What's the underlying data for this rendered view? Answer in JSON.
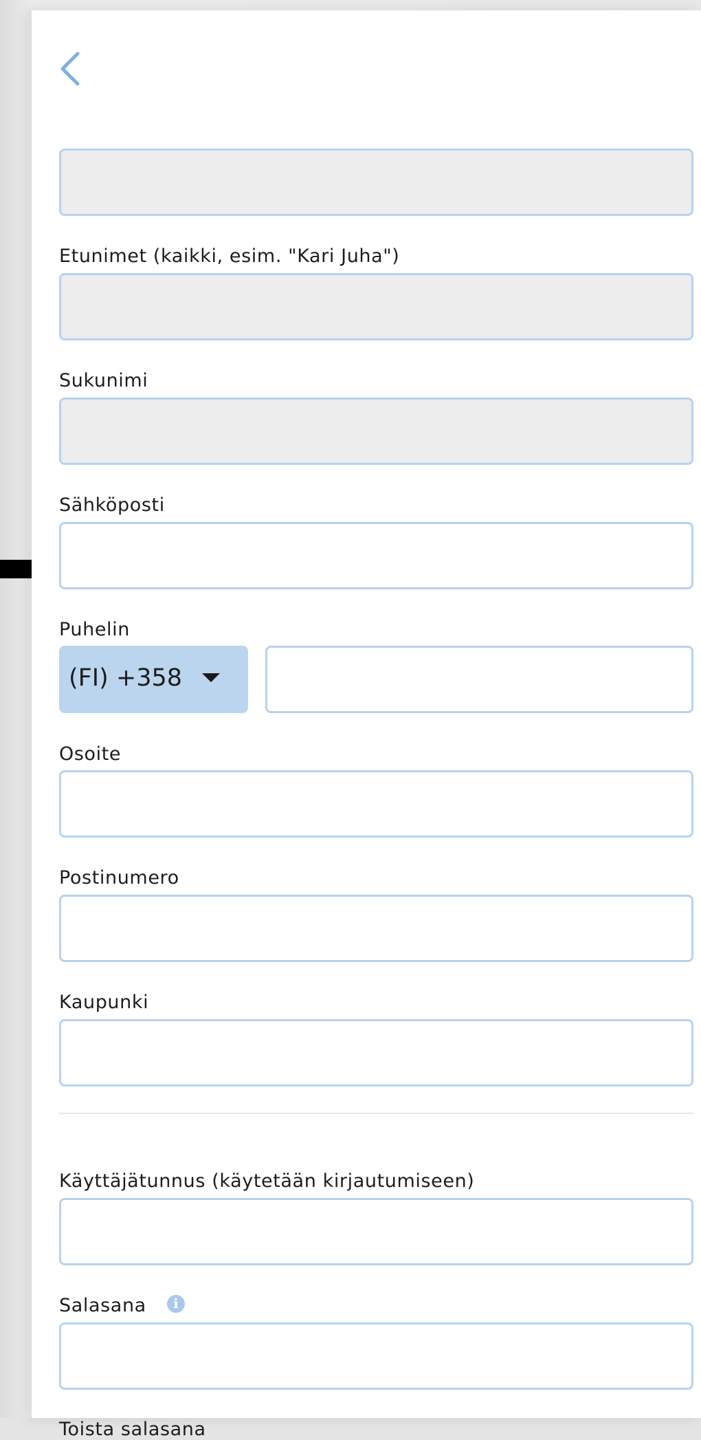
{
  "form": {
    "first_names_label": "Etunimet (kaikki, esim. \"Kari Juha\")",
    "last_name_label": "Sukunimi",
    "email_label": "Sähköposti",
    "phone_label": "Puhelin",
    "phone_country_code": "(FI) +358",
    "address_label": "Osoite",
    "postal_code_label": "Postinumero",
    "city_label": "Kaupunki",
    "username_label": "Käyttäjätunnus (käytetään kirjautumiseen)",
    "password_label": "Salasana",
    "repeat_password_label": "Toista salasana"
  },
  "icons": {
    "back": "chevron-left-icon",
    "password_info": "info-icon",
    "phone_select": "caret-down-icon"
  },
  "colors": {
    "accent": "#7fb0e4",
    "field_border": "#b7d3ee",
    "select_bg": "#bcd5ef",
    "disabled_bg": "#ededed"
  }
}
